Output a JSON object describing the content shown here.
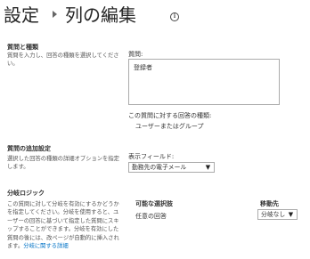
{
  "header": {
    "breadcrumb_root": "設定",
    "page_title": "列の編集"
  },
  "sections": {
    "question_type": {
      "title": "質問と種類",
      "description": "質問を入力し、回答の種類を選択してください。"
    },
    "additional_settings": {
      "title": "質問の追加設定",
      "description": "選択した回答の種類の詳細オプションを指定します。"
    },
    "branching": {
      "title": "分岐ロジック",
      "description": "この質問に対して分岐を有効にするかどうかを指定してください。分岐を使用すると、ユーザーの回答に基づいて指定した質問にスキップすることができます。分岐を有効にした質問の後には、改ページが自動的に挿入されます。",
      "link": "分岐に関する詳細"
    }
  },
  "form": {
    "question_label": "質問:",
    "question_value": "登録者",
    "answer_type_label": "この質問に対する回答の種類:",
    "answer_type_value": "ユーザーまたはグループ",
    "display_field_label": "表示フィールド:",
    "display_field_value": "勤務先の電子メール",
    "branch_possible_choices_header": "可能な選択肢",
    "branch_destination_header": "移動先",
    "branch_row_choice": "任意の回答",
    "branch_row_destination": "分岐なし"
  },
  "icons": {
    "info": "info-icon",
    "breadcrumb_separator": "triangle-right-icon",
    "dropdown": "chevron-down-icon"
  },
  "colors": {
    "link": "#0072c6",
    "title": "#262626",
    "text": "#444444",
    "border": "#ababab"
  }
}
